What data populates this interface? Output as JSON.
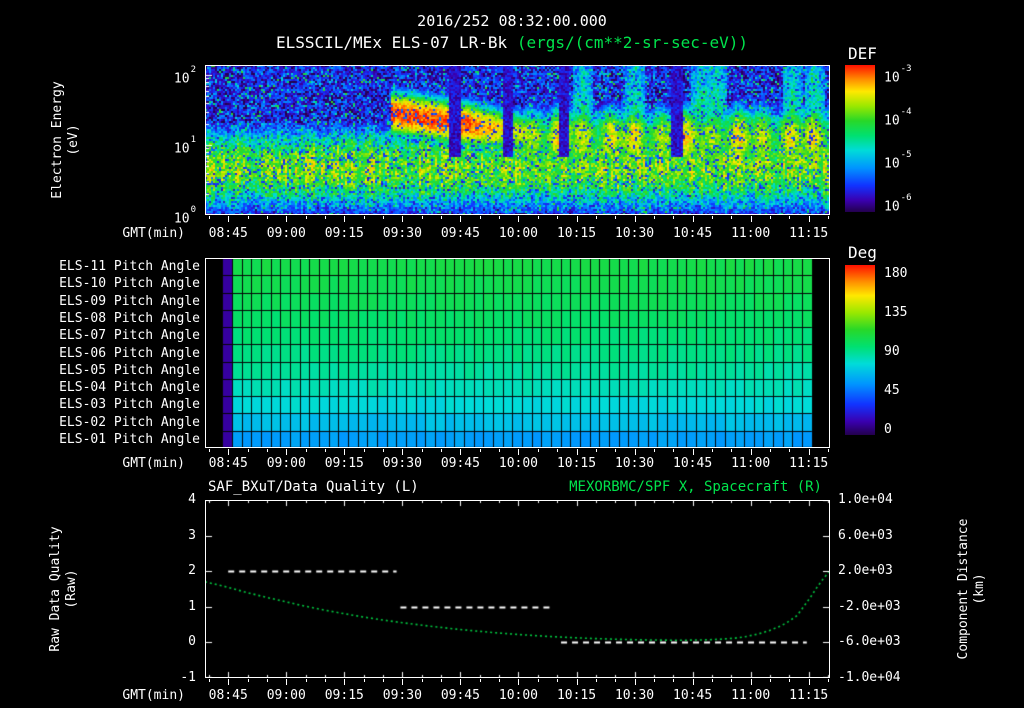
{
  "colors": {
    "background": "#000000",
    "text": "#ffffff",
    "accent_green": "#00e44c",
    "curve_green": "#00c840",
    "quality_line": "#ffffff",
    "rainbow_stops": [
      [
        0.0,
        "#23004d"
      ],
      [
        0.08,
        "#3a00b0"
      ],
      [
        0.18,
        "#1133ff"
      ],
      [
        0.3,
        "#0095ff"
      ],
      [
        0.42,
        "#00dcd8"
      ],
      [
        0.52,
        "#00e070"
      ],
      [
        0.62,
        "#28d828"
      ],
      [
        0.72,
        "#9ae800"
      ],
      [
        0.82,
        "#ffe800"
      ],
      [
        0.9,
        "#ff9000"
      ],
      [
        1.0,
        "#ff1000"
      ]
    ]
  },
  "header": {
    "timestamp": "2016/252 08:32:00.000",
    "instrument_title": "ELSSCIL/MEx ELS-07 LR-Bk",
    "units_label": "(ergs/(cm**2-sr-sec-eV))"
  },
  "time_axis": {
    "label": "GMT(min)",
    "domain_minutes": [
      519,
      680.5
    ],
    "minor_step_minutes": 5,
    "ticks": [
      {
        "label": "08:45",
        "minutes": 525
      },
      {
        "label": "09:00",
        "minutes": 540
      },
      {
        "label": "09:15",
        "minutes": 555
      },
      {
        "label": "09:30",
        "minutes": 570
      },
      {
        "label": "09:45",
        "minutes": 585
      },
      {
        "label": "10:00",
        "minutes": 600
      },
      {
        "label": "10:15",
        "minutes": 615
      },
      {
        "label": "10:30",
        "minutes": 630
      },
      {
        "label": "10:45",
        "minutes": 645
      },
      {
        "label": "11:00",
        "minutes": 660
      },
      {
        "label": "11:15",
        "minutes": 675
      }
    ]
  },
  "spectrogram": {
    "y_axis_label_line1": "Electron Energy",
    "y_axis_label_line2": "(eV)",
    "y_log_top": 2.143,
    "y_ticks": [
      {
        "base": "10",
        "exp": "2",
        "logE": 2
      },
      {
        "base": "10",
        "exp": "1",
        "logE": 1
      },
      {
        "base": "10",
        "exp": "0",
        "logE": 0
      }
    ],
    "colorbar": {
      "title": "DEF",
      "ticks": [
        {
          "base": "10",
          "exp": "-3"
        },
        {
          "base": "10",
          "exp": "-4"
        },
        {
          "base": "10",
          "exp": "-5"
        },
        {
          "base": "10",
          "exp": "-6"
        }
      ]
    }
  },
  "pitch_panel": {
    "grid_minutes": [
      523.5,
      675.8
    ],
    "columns": 61,
    "first_column_deg": 12,
    "rows": [
      {
        "label": "ELS-11 Pitch Angle",
        "pitch_deg": 103
      },
      {
        "label": "ELS-10 Pitch Angle",
        "pitch_deg": 101
      },
      {
        "label": "ELS-09 Pitch Angle",
        "pitch_deg": 99
      },
      {
        "label": "ELS-08 Pitch Angle",
        "pitch_deg": 96
      },
      {
        "label": "ELS-07 Pitch Angle",
        "pitch_deg": 93
      },
      {
        "label": "ELS-06 Pitch Angle",
        "pitch_deg": 90
      },
      {
        "label": "ELS-05 Pitch Angle",
        "pitch_deg": 86
      },
      {
        "label": "ELS-04 Pitch Angle",
        "pitch_deg": 81
      },
      {
        "label": "ELS-03 Pitch Angle",
        "pitch_deg": 75
      },
      {
        "label": "ELS-02 Pitch Angle",
        "pitch_deg": 66
      },
      {
        "label": "ELS-01 Pitch Angle",
        "pitch_deg": 57
      }
    ],
    "colorbar": {
      "title": "Deg",
      "ticks": [
        "180",
        "135",
        "90",
        "45",
        "0"
      ]
    }
  },
  "line_panel": {
    "left_title": "SAF_BXuT/Data Quality (L)",
    "right_title": "MEXORBMC/SPF X, Spacecraft (R)",
    "left_axis": {
      "line1": "Raw Data Quality",
      "line2": "(Raw)",
      "ticks": [
        "4",
        "3",
        "2",
        "1",
        "0",
        "-1"
      ],
      "min": -1,
      "max": 4
    },
    "right_axis": {
      "line1": "Component Distance",
      "line2": "(km)",
      "ticks": [
        "1.0e+04",
        "6.0e+03",
        "2.0e+03",
        "-2.0e+03",
        "-6.0e+03",
        "-1.0e+04"
      ],
      "min": -10000,
      "max": 10000
    }
  },
  "chart_data": [
    {
      "type": "heatmap",
      "panel": "electron-energy-spectrogram",
      "title": "ELSSCIL/MEx ELS-07 LR-Bk",
      "value_units": "ergs/(cm**2-sr-sec-eV)",
      "xlabel": "GMT(min), 08:39 to 11:20",
      "ylabel": "Electron Energy (eV), log scale 1 to 140",
      "value_log10_range": [
        -6.5,
        -3
      ],
      "features": {
        "background_logDEF": -6.2,
        "ionosphere_band": {
          "logE_center": 0.68,
          "logE_halfwidth": 0.34,
          "logDEF": -4.15,
          "t_minutes": [
            519,
            680.5
          ]
        },
        "sheath_wedge": {
          "t_minutes": [
            567,
            602
          ],
          "logE_center_start": 1.47,
          "logE_center_end": 1.17,
          "logE_halfwidth": 0.22,
          "logDEF_peak": -3.15
        },
        "magnetosheath_blobs": {
          "t_minutes": [
            601,
            680.5
          ],
          "logE_center": 1.12,
          "logE_halfwidth": 0.3,
          "logDEF": -4.1
        },
        "plumes_t_minutes": [
          616.5,
          630,
          647,
          651,
          670.5,
          676.5
        ],
        "dropouts_t_minutes": [
          583.5,
          597,
          611.5,
          640.5
        ]
      }
    },
    {
      "type": "heatmap",
      "panel": "pitch-angle-grid",
      "value_units": "Deg",
      "value_range": [
        0,
        180
      ],
      "t_minutes": [
        523.5,
        675.8
      ],
      "rows": [
        "ELS-11",
        "ELS-10",
        "ELS-09",
        "ELS-08",
        "ELS-07",
        "ELS-06",
        "ELS-05",
        "ELS-04",
        "ELS-03",
        "ELS-02",
        "ELS-01"
      ],
      "row_pitch_deg": [
        103,
        101,
        99,
        96,
        93,
        90,
        86,
        81,
        75,
        66,
        57
      ]
    },
    {
      "type": "line",
      "panel": "quality-and-distance",
      "left_ylim": [
        -1,
        4
      ],
      "right_ylim": [
        -10000,
        10000
      ],
      "series": [
        {
          "name": "SAF_BXuT/Data Quality (L)",
          "axis": "left",
          "style": "dashed",
          "color": "#ffffff",
          "segments": [
            {
              "t_minutes": [
                525,
                568.5
              ],
              "value": 2
            },
            {
              "t_minutes": [
                569.5,
                609
              ],
              "value": 1
            },
            {
              "t_minutes": [
                611,
                674.5
              ],
              "value": 0
            }
          ]
        },
        {
          "name": "MEXORBMC/SPF X, Spacecraft (R)",
          "axis": "right",
          "style": "dotted",
          "color": "#00c840",
          "points_t_km": [
            [
              519,
              800
            ],
            [
              524,
              300
            ],
            [
              529,
              -300
            ],
            [
              534,
              -850
            ],
            [
              539,
              -1350
            ],
            [
              544,
              -1850
            ],
            [
              549,
              -2300
            ],
            [
              554,
              -2700
            ],
            [
              559,
              -3080
            ],
            [
              564,
              -3420
            ],
            [
              569,
              -3730
            ],
            [
              574,
              -4010
            ],
            [
              579,
              -4270
            ],
            [
              584,
              -4510
            ],
            [
              589,
              -4720
            ],
            [
              594,
              -4910
            ],
            [
              599,
              -5080
            ],
            [
              604,
              -5230
            ],
            [
              609,
              -5360
            ],
            [
              614,
              -5470
            ],
            [
              619,
              -5560
            ],
            [
              624,
              -5630
            ],
            [
              629,
              -5690
            ],
            [
              634,
              -5730
            ],
            [
              639,
              -5750
            ],
            [
              644,
              -5750
            ],
            [
              648,
              -5720
            ],
            [
              652,
              -5650
            ],
            [
              656,
              -5520
            ],
            [
              659,
              -5330
            ],
            [
              662,
              -5050
            ],
            [
              665,
              -4650
            ],
            [
              668,
              -4100
            ],
            [
              670,
              -3600
            ],
            [
              672,
              -2980
            ],
            [
              674,
              -1800
            ],
            [
              675.5,
              -900
            ],
            [
              677,
              100
            ],
            [
              678.5,
              1000
            ],
            [
              679.8,
              1700
            ],
            [
              680.5,
              2100
            ]
          ]
        }
      ]
    }
  ]
}
